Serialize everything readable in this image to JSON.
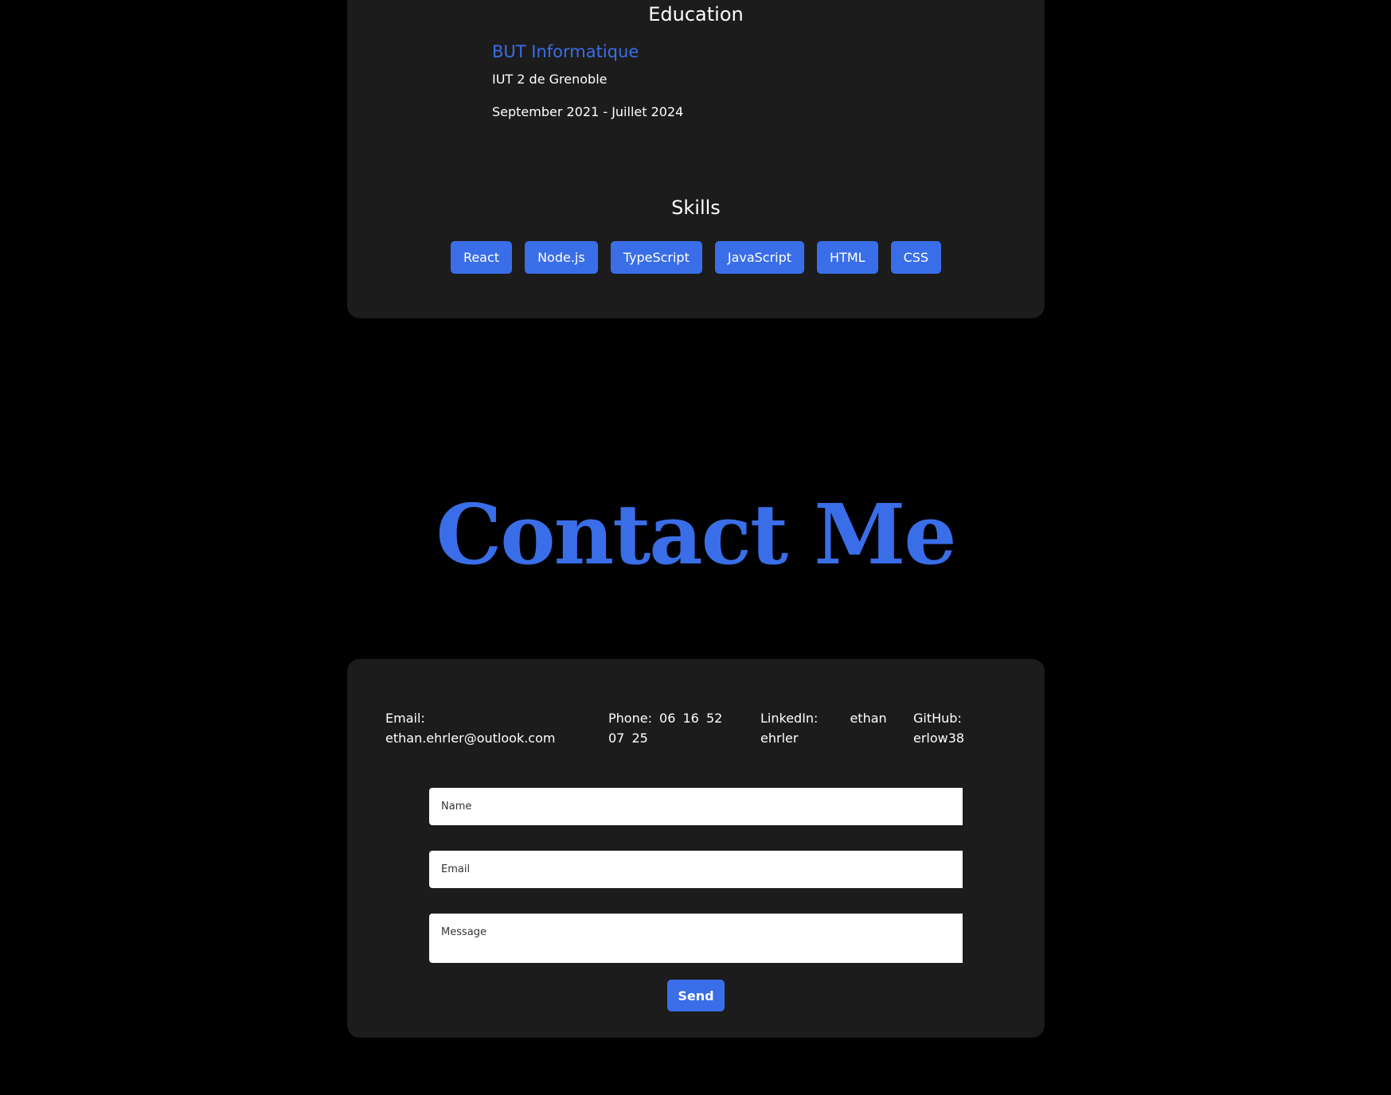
{
  "education": {
    "title": "Education",
    "degree": "BUT Informatique",
    "school": "IUT 2 de Grenoble",
    "dates": "September 2021 - Juillet 2024"
  },
  "skills": {
    "title": "Skills",
    "items": [
      "React",
      "Node.js",
      "TypeScript",
      "JavaScript",
      "HTML",
      "CSS"
    ]
  },
  "contact": {
    "heading": "Contact Me",
    "email_label": "Email:",
    "email_value": "ethan.ehrler@outlook.com",
    "phone_label": "Phone:",
    "phone_value": "06 16 52 07 25",
    "linkedin_label": "LinkedIn:",
    "linkedin_value_first": "ethan",
    "linkedin_value_last": "ehrler",
    "github_label": "GitHub:",
    "github_value": "erlow38",
    "form": {
      "name_placeholder": "Name",
      "email_placeholder": "Email",
      "message_placeholder": "Message",
      "send_label": "Send"
    }
  },
  "colors": {
    "background": "#000000",
    "card": "#1c1c1c",
    "accent": "#3a6ee8",
    "text": "#ffffff"
  }
}
